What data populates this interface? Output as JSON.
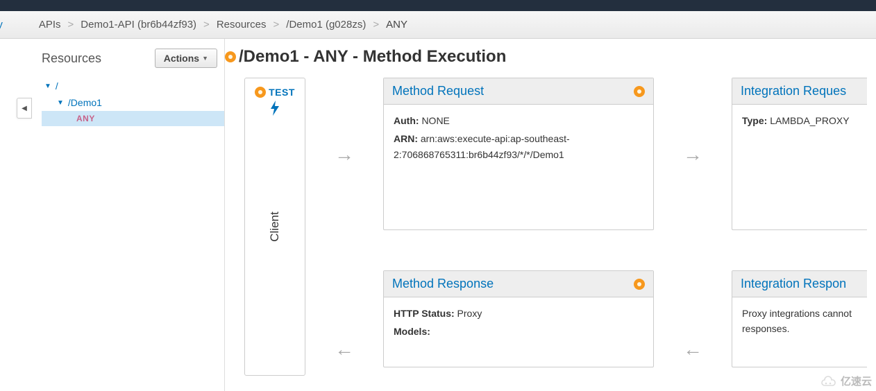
{
  "breadcrumb": {
    "service": "ay",
    "items": [
      "APIs",
      "Demo1-API (br6b44zf93)",
      "Resources",
      "/Demo1 (g028zs)",
      "ANY"
    ]
  },
  "sidebar": {
    "title": "Resources",
    "actions_label": "Actions",
    "tree": {
      "root": "/",
      "child": "/Demo1",
      "method": "ANY"
    }
  },
  "page": {
    "heading": "/Demo1 - ANY - Method Execution"
  },
  "test": {
    "label": "TEST",
    "client_label": "Client"
  },
  "method_request": {
    "title": "Method Request",
    "auth_label": "Auth:",
    "auth_value": "NONE",
    "arn_label": "ARN:",
    "arn_value": "arn:aws:execute-api:ap-southeast-2:706868765311:br6b44zf93/*/*/Demo1"
  },
  "method_response": {
    "title": "Method Response",
    "http_label": "HTTP Status:",
    "http_value": "Proxy",
    "models_label": "Models:"
  },
  "integration_request": {
    "title": "Integration Reques",
    "type_label": "Type:",
    "type_value": "LAMBDA_PROXY"
  },
  "integration_response": {
    "title": "Integration Respon",
    "body": "Proxy integrations cannot responses."
  },
  "watermark": "亿速云"
}
